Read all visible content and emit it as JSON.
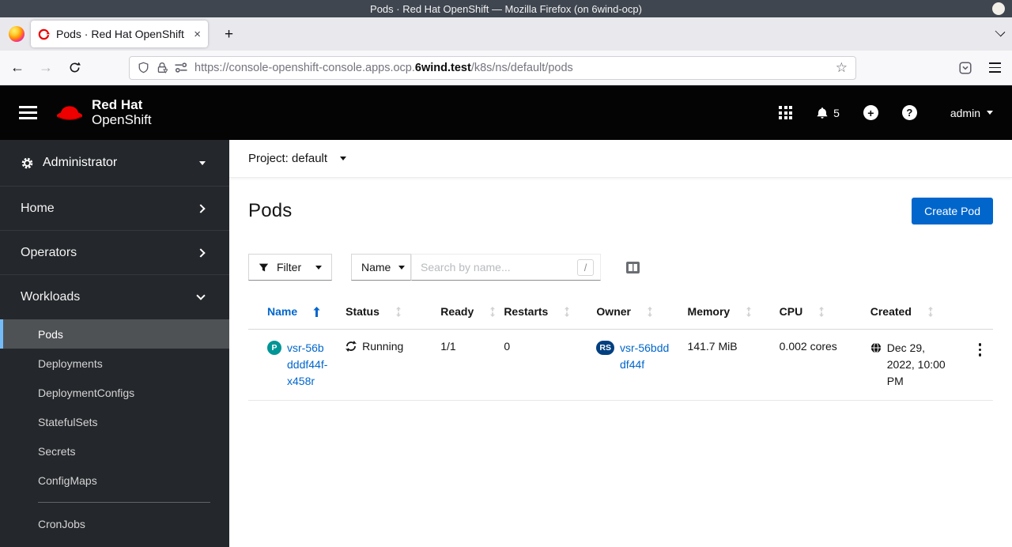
{
  "window": {
    "title": "Pods · Red Hat OpenShift — Mozilla Firefox (on 6wind-ocp)"
  },
  "browser": {
    "tab": {
      "title": "Pods · Red Hat OpenShift",
      "close": "×"
    },
    "new_tab": "+",
    "nav": {
      "back": "←",
      "forward": "→"
    },
    "url": {
      "prefix": "https://console-openshift-console.apps.ocp.",
      "domain": "6wind.test",
      "path": "/k8s/ns/default/pods"
    },
    "bookmark_star": "☆"
  },
  "masthead": {
    "brand": {
      "line1": "Red Hat",
      "line2": "OpenShift"
    },
    "notifications": {
      "count": "5"
    },
    "add_label": "+",
    "help_label": "?",
    "user": {
      "name": "admin"
    }
  },
  "sidebar": {
    "perspective": {
      "label": "Administrator"
    },
    "sections": [
      {
        "label": "Home"
      },
      {
        "label": "Operators"
      },
      {
        "label": "Workloads"
      }
    ],
    "workloads": [
      {
        "label": "Pods"
      },
      {
        "label": "Deployments"
      },
      {
        "label": "DeploymentConfigs"
      },
      {
        "label": "StatefulSets"
      },
      {
        "label": "Secrets"
      },
      {
        "label": "ConfigMaps"
      },
      {
        "label": "CronJobs"
      }
    ]
  },
  "page": {
    "project_bar": {
      "label": "Project: default"
    },
    "title": "Pods",
    "create_button": "Create Pod",
    "toolbar": {
      "filter": "Filter",
      "attribute": "Name",
      "search_placeholder": "Search by name...",
      "shortcut": "/"
    },
    "table": {
      "columns": [
        {
          "label": "Name"
        },
        {
          "label": "Status"
        },
        {
          "label": "Ready"
        },
        {
          "label": "Restarts"
        },
        {
          "label": "Owner"
        },
        {
          "label": "Memory"
        },
        {
          "label": "CPU"
        },
        {
          "label": "Created"
        }
      ],
      "rows": [
        {
          "badge": "P",
          "name": "vsr-56bdddf44f-x458r",
          "status": "Running",
          "ready": "1/1",
          "restarts": "0",
          "owner_badge": "RS",
          "owner": "vsr-56bdddf44f",
          "memory": "141.7 MiB",
          "cpu": "0.002 cores",
          "created": "Dec 29, 2022, 10:00 PM"
        }
      ]
    }
  },
  "colors": {
    "brand_red": "#ee0000",
    "link_blue": "#0066cc",
    "button_blue": "#0066cc",
    "masthead_bg": "#040404",
    "sidebar_bg": "#24272b",
    "sidebar_selected_bg": "#4f5255",
    "sidebar_selected_border": "#73bcf7",
    "pod_badge_bg": "#009596",
    "replicaset_badge_bg": "#004080"
  }
}
